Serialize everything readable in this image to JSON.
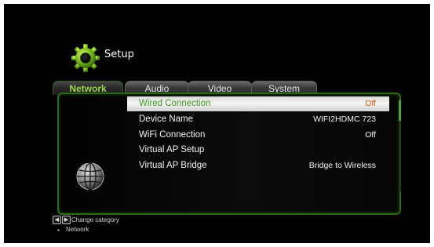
{
  "header": {
    "title": "Setup",
    "icon": "gear-icon"
  },
  "tabs": [
    {
      "label": "Network",
      "active": true
    },
    {
      "label": "Audio",
      "active": false
    },
    {
      "label": "Video",
      "active": false
    },
    {
      "label": "System",
      "active": false
    }
  ],
  "settings": [
    {
      "label": "Wired Connection",
      "value": "Off",
      "selected": true
    },
    {
      "label": "Device Name",
      "value": "WIFI2HDMC 723",
      "selected": false
    },
    {
      "label": "WiFi Connection",
      "value": "Off",
      "selected": false
    },
    {
      "label": "Virtual AP Setup",
      "value": "",
      "selected": false
    },
    {
      "label": "Virtual AP Bridge",
      "value": "Bridge to Wireless",
      "selected": false
    }
  ],
  "category_icon": "globe-icon",
  "footer": {
    "hint": "Change category",
    "hint_icons": [
      "arrow-left-icon",
      "arrow-right-icon"
    ],
    "breadcrumb": "Network"
  },
  "colors": {
    "background": "#000000",
    "active_tab_text": "#9fd64a",
    "panel_border": "#2a6a16",
    "selected_label": "#3d9a1a",
    "selected_value": "#e0590e",
    "selected_row_bg": "#efefef",
    "text": "#f2f2f2"
  },
  "scrollbar": {
    "visible_fraction": 0.22,
    "position": 0
  }
}
